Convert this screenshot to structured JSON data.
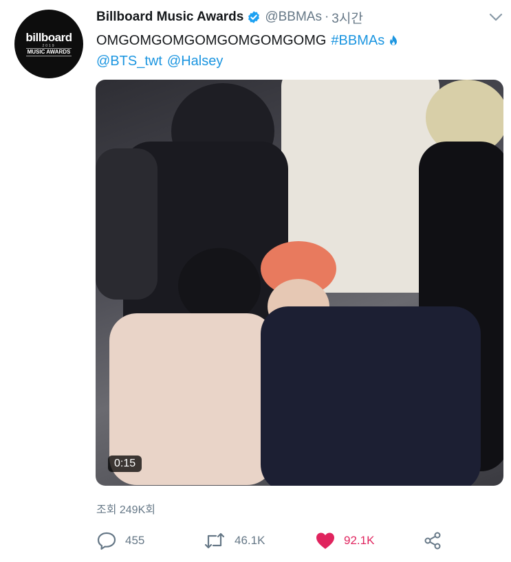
{
  "account": {
    "display_name": "Billboard Music Awards",
    "handle": "@BBMAs",
    "separator": "·",
    "time": "3시간",
    "avatar_logo": {
      "main": "billboard",
      "year": "2019",
      "sub": "MUSIC AWARDS"
    }
  },
  "tweet": {
    "text": "OMGOMGOMGOMGOMGOMGOMG",
    "hashtag": "#BBMAs",
    "mentions": [
      "@BTS_twt",
      "@Halsey"
    ]
  },
  "media": {
    "duration": "0:15"
  },
  "stats": {
    "views": "조회 249K회"
  },
  "actions": {
    "replies": "455",
    "retweets": "46.1K",
    "likes": "92.1K"
  },
  "colors": {
    "link": "#1b95e0",
    "like": "#e0245e",
    "muted": "#657786",
    "verified": "#1da1f2"
  }
}
